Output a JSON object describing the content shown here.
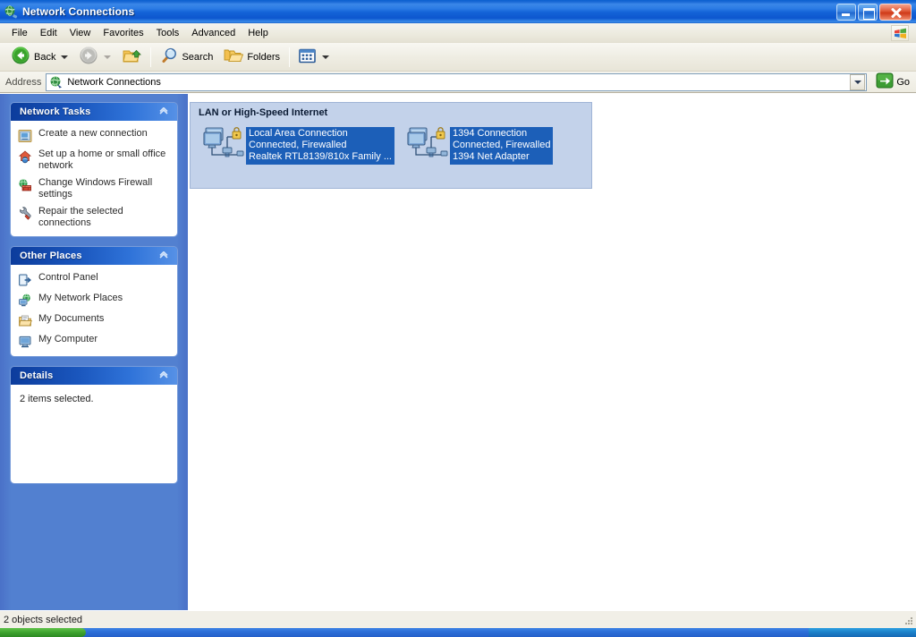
{
  "window": {
    "title": "Network Connections",
    "title_icon": "network-globe-icon",
    "minimize_label": "Minimize",
    "maximize_label": "Restore",
    "close_label": "Close"
  },
  "menu": {
    "items": [
      {
        "label": "File"
      },
      {
        "label": "Edit"
      },
      {
        "label": "View"
      },
      {
        "label": "Favorites"
      },
      {
        "label": "Tools"
      },
      {
        "label": "Advanced"
      },
      {
        "label": "Help"
      }
    ],
    "flag_icon": "windows-flag-icon"
  },
  "toolbar": {
    "back_label": "Back",
    "back_icon": "back-arrow-icon",
    "forward_icon": "forward-arrow-icon",
    "up_icon": "up-folder-icon",
    "search_label": "Search",
    "search_icon": "search-magnifier-icon",
    "folders_label": "Folders",
    "folders_icon": "folders-icon",
    "views_icon": "views-icon"
  },
  "address": {
    "label": "Address",
    "value": "Network Connections",
    "icon": "network-globe-icon",
    "dropdown_icon": "chevron-down-icon",
    "go_label": "Go",
    "go_icon": "go-arrow-icon"
  },
  "sidebar": {
    "panels": [
      {
        "title": "Network Tasks",
        "collapse_icon": "chevron-up-icon",
        "items": [
          {
            "label": "Create a new connection",
            "icon": "new-connection-icon"
          },
          {
            "label": "Set up a home or small office network",
            "icon": "home-network-icon"
          },
          {
            "label": "Change Windows Firewall settings",
            "icon": "firewall-icon"
          },
          {
            "label": "Repair the selected connections",
            "icon": "repair-wrench-icon"
          }
        ]
      },
      {
        "title": "Other Places",
        "collapse_icon": "chevron-up-icon",
        "items": [
          {
            "label": "Control Panel",
            "icon": "control-panel-icon"
          },
          {
            "label": "My Network Places",
            "icon": "my-network-places-icon"
          },
          {
            "label": "My Documents",
            "icon": "my-documents-icon"
          },
          {
            "label": "My Computer",
            "icon": "my-computer-icon"
          }
        ]
      },
      {
        "title": "Details",
        "collapse_icon": "chevron-up-icon",
        "detail_text": "2 items selected."
      }
    ]
  },
  "content": {
    "group_title": "LAN or High-Speed Internet",
    "connections": [
      {
        "name": "Local Area Connection",
        "status": "Connected, Firewalled",
        "device": "Realtek RTL8139/810x Family ...",
        "icon": "network-connection-icon",
        "selected": true
      },
      {
        "name": "1394 Connection",
        "status": "Connected, Firewalled",
        "device": "1394 Net Adapter",
        "icon": "network-connection-icon",
        "selected": true
      }
    ]
  },
  "statusbar": {
    "text": "2 objects selected"
  },
  "colors": {
    "titlebar_blue": "#1a69d6",
    "sidebar_blue": "#5280d0",
    "panel_header_blue": "#1a56bd",
    "selection_blue": "#1c5fb8",
    "group_box_bg": "#c3d2ea",
    "close_red": "#cf3a18"
  }
}
